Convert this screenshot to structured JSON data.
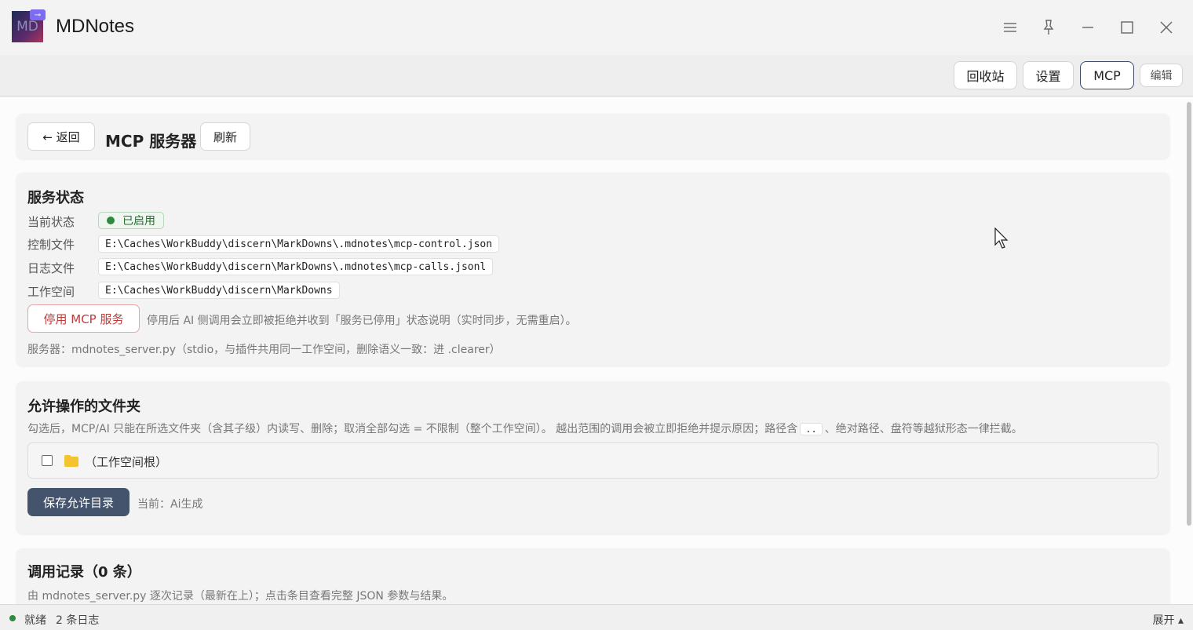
{
  "app": {
    "logo_text": "MD",
    "title": "MDNotes"
  },
  "window_controls": {
    "menu_icon": "menu-icon",
    "pin_icon": "pin-icon",
    "minimize_icon": "minimize-icon",
    "maximize_icon": "maximize-icon",
    "close_icon": "close-icon"
  },
  "toolbar": {
    "recycle_label": "回收站",
    "settings_label": "设置",
    "mcp_label": "MCP",
    "edit_label": "编辑"
  },
  "header": {
    "back_label": "← 返回",
    "title": "MCP 服务器",
    "refresh_label": "刷新"
  },
  "service": {
    "heading": "服务状态",
    "status_label": "当前状态",
    "status_value": "已启用",
    "control_file_label": "控制文件",
    "control_file_value": "E:\\Caches\\WorkBuddy\\discern\\MarkDowns\\.mdnotes\\mcp-control.json",
    "log_file_label": "日志文件",
    "log_file_value": "E:\\Caches\\WorkBuddy\\discern\\MarkDowns\\.mdnotes\\mcp-calls.jsonl",
    "workspace_label": "工作空间",
    "workspace_value": "E:\\Caches\\WorkBuddy\\discern\\MarkDowns",
    "disable_label": "停用 MCP 服务",
    "disable_hint": "停用后 AI 侧调用会立即被拒绝并收到「服务已停用」状态说明（实时同步，无需重启）。",
    "server_info": "服务器：mdnotes_server.py（stdio，与插件共用同一工作空间，删除语义一致：进 .clearer）"
  },
  "folders": {
    "heading": "允许操作的文件夹",
    "desc_prefix": "勾选后，MCP/AI 只能在所选文件夹（含其子级）内读写、删除；取消全部勾选 = 不限制（整个工作空间）。 越出范围的调用会被立即拒绝并提示原因；路径含",
    "desc_code": "..",
    "desc_suffix": "、绝对路径、盘符等越狱形态一律拦截。",
    "root_label": "（工作空间根）",
    "save_label": "保存允许目录",
    "current_text": "当前：Ai生成"
  },
  "calls": {
    "heading": "调用记录（0 条）",
    "desc": "由 mdnotes_server.py 逐次记录（最新在上）；点击条目查看完整 JSON 参数与结果。"
  },
  "statusbar": {
    "ready": "就绪",
    "logs": "2 条日志",
    "expand": "展开 ▴"
  },
  "colors": {
    "accent": "#45546d",
    "success": "#2e8b3c",
    "danger": "#c03a3a"
  }
}
